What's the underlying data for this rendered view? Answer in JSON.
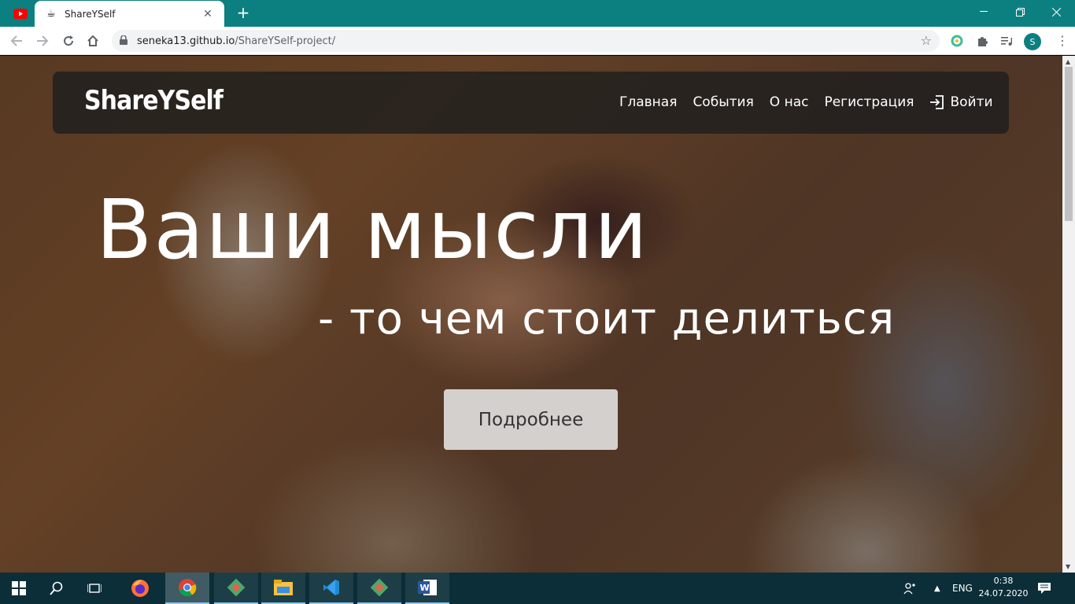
{
  "browser": {
    "tab_title": "ShareYSelf",
    "close_glyph": "✕",
    "newtab_glyph": "+",
    "url_host": "seneka13.github.io",
    "url_path": "/ShareYSelf-project/",
    "profile_initial": "S"
  },
  "site": {
    "logo": "ShareYSelf",
    "nav": {
      "home": "Главная",
      "events": "События",
      "about": "О нас",
      "register": "Регистрация",
      "login": "Войти"
    },
    "hero": {
      "title": "Ваши мысли",
      "subtitle": "- то чем стоит делиться",
      "button": "Подробнее"
    }
  },
  "taskbar": {
    "lang": "ENG",
    "time": "0:38",
    "date": "24.07.2020"
  },
  "colors": {
    "titlebar": "#0c8080",
    "taskbar": "#0b2e38",
    "navbar": "#1e1e1e"
  }
}
